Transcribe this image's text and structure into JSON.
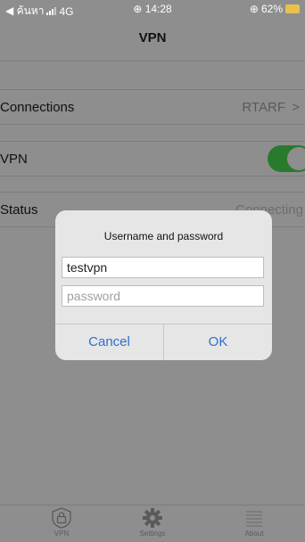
{
  "status_bar": {
    "back_label": "◀ ค้นหา",
    "network": "4G",
    "time": "14:28",
    "battery": "62%",
    "lock_rotation_glyph": "⊕",
    "time_glyph": "⊕"
  },
  "nav": {
    "title": "VPN"
  },
  "rows": {
    "connections": {
      "label": "Connections",
      "value": "RTARF",
      "chevron": ">"
    },
    "vpn": {
      "label": "VPN",
      "toggle_on": true
    },
    "status": {
      "label": "Status",
      "value": "Connecting"
    }
  },
  "dialog": {
    "title": "Username and password",
    "username_value": "testvpn",
    "password_placeholder": "password",
    "cancel_label": "Cancel",
    "ok_label": "OK"
  },
  "tabs": [
    {
      "label": "VPN",
      "icon": "lock-icon"
    },
    {
      "label": "Settings",
      "icon": "gear-icon"
    },
    {
      "label": "About",
      "icon": "list-icon"
    }
  ],
  "colors": {
    "accent_blue": "#2f6fcf",
    "toggle_green": "#2a7a2e",
    "battery_yellow": "#e9c24b"
  }
}
